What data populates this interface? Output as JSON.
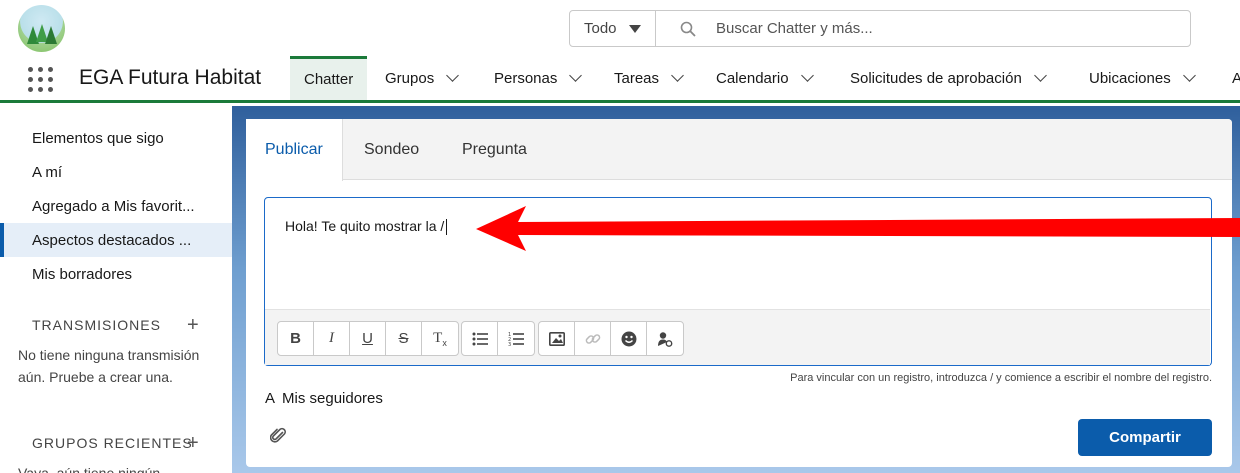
{
  "header": {
    "search_scope": "Todo",
    "search_placeholder": "Buscar Chatter y más..."
  },
  "nav": {
    "app_name": "EGA Futura Habitat",
    "items": [
      {
        "label": "Chatter"
      },
      {
        "label": "Grupos"
      },
      {
        "label": "Personas"
      },
      {
        "label": "Tareas"
      },
      {
        "label": "Calendario"
      },
      {
        "label": "Solicitudes de aprobación"
      },
      {
        "label": "Ubicaciones"
      },
      {
        "label": "A"
      }
    ]
  },
  "sidebar": {
    "items": [
      {
        "label": "Elementos que sigo"
      },
      {
        "label": "A mí"
      },
      {
        "label": "Agregado a Mis favorit..."
      },
      {
        "label": "Aspectos destacados ..."
      },
      {
        "label": "Mis borradores"
      }
    ],
    "streams_heading": "TRANSMISIONES",
    "streams_plus": "+",
    "streams_empty": "No tiene ninguna transmisión aún. Pruebe a crear una.",
    "recent_groups_heading": "GRUPOS RECIENTES",
    "recent_groups_plus": "+",
    "recent_groups_text": "Vaya, aún tiene ningún"
  },
  "publisher": {
    "tabs": [
      {
        "label": "Publicar"
      },
      {
        "label": "Sondeo"
      },
      {
        "label": "Pregunta"
      }
    ],
    "editor_text": "Hola! Te quito mostrar la /",
    "toolbar": {
      "bold": "B",
      "italic": "I",
      "underline": "U",
      "strike": "S",
      "clear_format": "T"
    },
    "hint": "Para vincular con un registro, introduzca / y comience a escribir el nombre del registro.",
    "audience_icon": "A",
    "audience": "Mis seguidores",
    "share_label": "Compartir"
  },
  "colors": {
    "accent": "#0b5cab",
    "nav_active": "#1b7a3a",
    "annotation_arrow": "#ff0000"
  }
}
